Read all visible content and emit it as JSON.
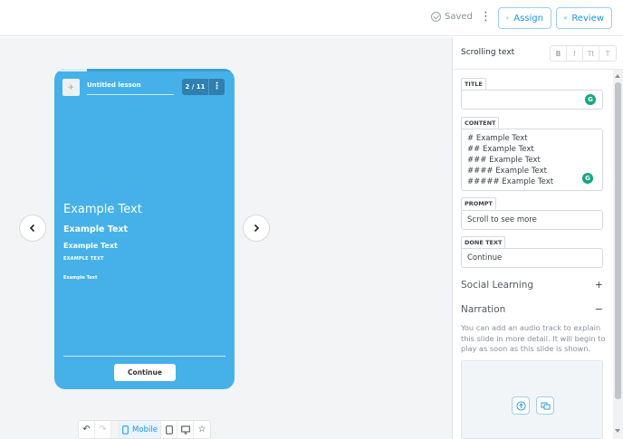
{
  "header": {
    "saved_label": "Saved",
    "assign_label": "Assign",
    "review_label": "Review",
    "colors": {
      "accent": "#1b95e0"
    }
  },
  "preview": {
    "lesson_title": "Untitled lesson",
    "slide_counter": "2 / 11",
    "progress": 0.18,
    "headings": [
      "Example Text",
      "Example Text",
      "Example Text",
      "EXAMPLE TEXT",
      "Example Text"
    ],
    "continue_label": "Continue",
    "colors": {
      "slide_background": "#45b1e8"
    }
  },
  "toolbar": {
    "mobile_label": "Mobile",
    "icons": [
      "undo-icon",
      "redo-icon",
      "mobile-icon",
      "tablet-icon",
      "desktop-icon",
      "star-icon"
    ]
  },
  "panel": {
    "title": "Scrolling text",
    "format_buttons": [
      "B",
      "I",
      "Tt",
      "T"
    ],
    "fields": {
      "title_label": "TITLE",
      "title_value": "",
      "content_label": "CONTENT",
      "content_lines": [
        "# Example Text",
        "## Example Text",
        "### Example Text",
        "#### Example Text",
        "##### Example Text"
      ],
      "prompt_label": "PROMPT",
      "prompt_value": "Scroll to see more",
      "done_label": "DONE TEXT",
      "done_value": "Continue"
    },
    "social_learning": "Social Learning",
    "narration": "Narration",
    "narration_help": "You can add an audio track to explain this slide in more detail. It will begin to play as soon as this slide is shown."
  }
}
